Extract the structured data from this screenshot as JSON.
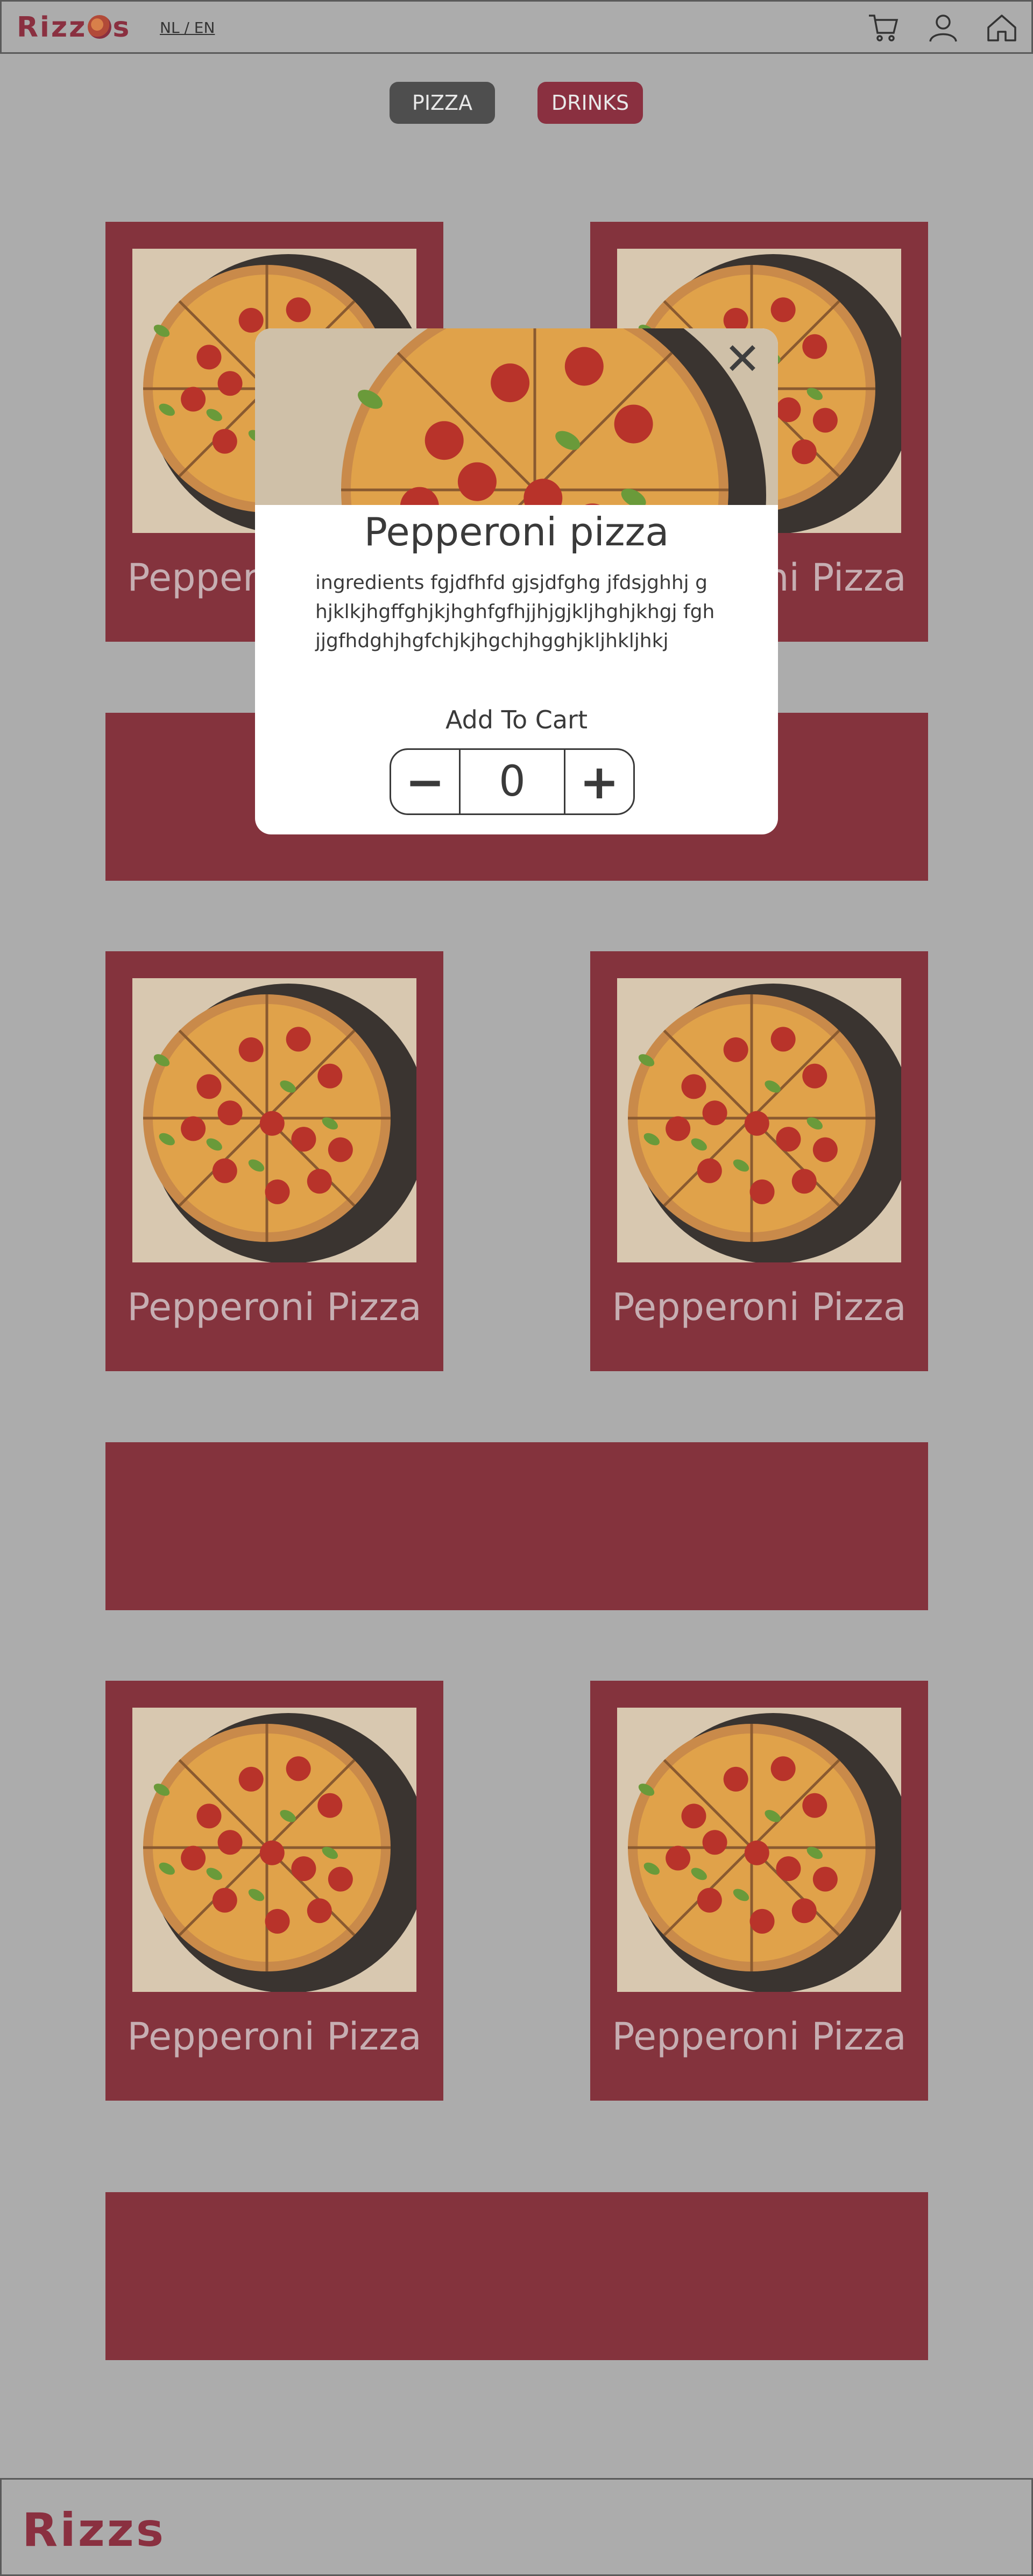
{
  "header": {
    "logo_text": "Rizz",
    "logo_text_end": "s",
    "lang_label": "NL / EN",
    "icons": [
      "cart-icon",
      "user-icon",
      "home-icon"
    ]
  },
  "categories": [
    {
      "label": "PIZZA",
      "active": true
    },
    {
      "label": "DRINKS",
      "active": false
    }
  ],
  "products": [
    {
      "name": "Pepperoni Pizza"
    },
    {
      "name": "Pepperoni Pizza"
    },
    {
      "name": "Pepperoni Pizza"
    },
    {
      "name": "Pepperoni Pizza"
    },
    {
      "name": "Pepperoni Pizza"
    },
    {
      "name": "Pepperoni Pizza"
    }
  ],
  "modal": {
    "title": "Pepperoni pizza",
    "description": "ingredients fgjdfhfd gjsjdfghg jfdsjghhj ghjklkjhgffghjkjhghfgfhjjhjgjkljhghjkhgj fghjjgfhdghjhgfchjkjhgchjhgghjkljhkljhkj",
    "add_to_cart_label": "Add To Cart",
    "quantity": "0",
    "minus_label": "−",
    "plus_label": "+",
    "close_label": "✕"
  },
  "footer": {
    "logo_text": "Rizz",
    "logo_text_end": "s"
  },
  "colors": {
    "background": "#acacac",
    "brand": "#84333d",
    "active_tab": "#4e4e4e"
  }
}
